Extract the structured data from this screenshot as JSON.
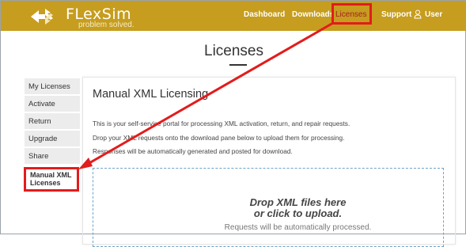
{
  "header": {
    "brand": "FLexSim",
    "tagline": "problem solved.",
    "nav": {
      "dashboard": "Dashboard",
      "downloads": "Downloads",
      "licenses": "Licenses",
      "support": "Support",
      "user": "User"
    },
    "colors": {
      "bar": "#c69d1f",
      "highlight": "#e21c1c"
    }
  },
  "page": {
    "title": "Licenses"
  },
  "sidebar": {
    "items": [
      {
        "label": "My Licenses"
      },
      {
        "label": "Activate"
      },
      {
        "label": "Return"
      },
      {
        "label": "Upgrade"
      },
      {
        "label": "Share"
      }
    ],
    "active": "Manual XML Licenses"
  },
  "panel": {
    "title": "Manual XML Licensing",
    "lines": [
      "This is your self-service portal for processing XML activation, return, and repair requests.",
      "Drop your XML requests onto the download pane below to upload them for processing.",
      "Responses will be automatically generated and posted for download."
    ]
  },
  "dropzone": {
    "heading_line1": "Drop XML files here",
    "heading_line2": "or click to upload.",
    "subtext": "Requests will be automatically processed."
  }
}
